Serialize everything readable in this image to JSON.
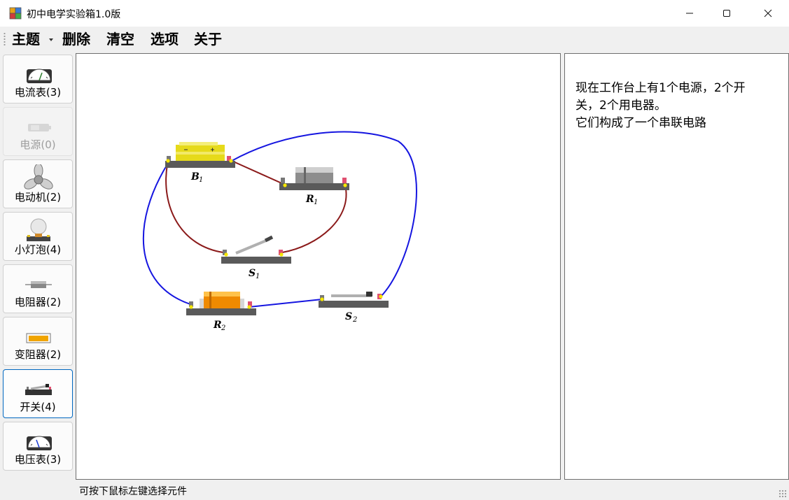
{
  "window": {
    "title": "初中电学实验箱1.0版"
  },
  "menu": {
    "theme": "主题",
    "delete": "删除",
    "clear": "清空",
    "options": "选项",
    "about": "关于"
  },
  "sidebar": {
    "items": [
      {
        "label": "电流表(3)",
        "icon": "ammeter-icon",
        "enabled": true,
        "selected": false
      },
      {
        "label": "电源(0)",
        "icon": "battery-icon",
        "enabled": false,
        "selected": false
      },
      {
        "label": "电动机(2)",
        "icon": "motor-fan-icon",
        "enabled": true,
        "selected": false
      },
      {
        "label": "小灯泡(4)",
        "icon": "bulb-icon",
        "enabled": true,
        "selected": false
      },
      {
        "label": "电阻器(2)",
        "icon": "resistor-icon",
        "enabled": true,
        "selected": false
      },
      {
        "label": "变阻器(2)",
        "icon": "rheostat-icon",
        "enabled": true,
        "selected": false
      },
      {
        "label": "开关(4)",
        "icon": "switch-icon",
        "enabled": true,
        "selected": true
      },
      {
        "label": "电压表(3)",
        "icon": "voltmeter-icon",
        "enabled": true,
        "selected": false
      }
    ]
  },
  "workbench": {
    "components": [
      {
        "letter": "B",
        "sub": "1",
        "type": "battery"
      },
      {
        "letter": "R",
        "sub": "1",
        "type": "resistor"
      },
      {
        "letter": "S",
        "sub": "1",
        "type": "switch"
      },
      {
        "letter": "R",
        "sub": "2",
        "type": "rheostat"
      },
      {
        "letter": "S",
        "sub": "2",
        "type": "switch"
      }
    ],
    "wire_colors": {
      "dark_red": "#8b1a1a",
      "blue": "#1515e0"
    }
  },
  "info": {
    "line1": "现在工作台上有1个电源，2个开",
    "line2": "关，2个用电器。",
    "line3": "它们构成了一个串联电路"
  },
  "status": {
    "text": "可按下鼠标左键选择元件"
  },
  "colors": {
    "accent": "#0067c0"
  }
}
